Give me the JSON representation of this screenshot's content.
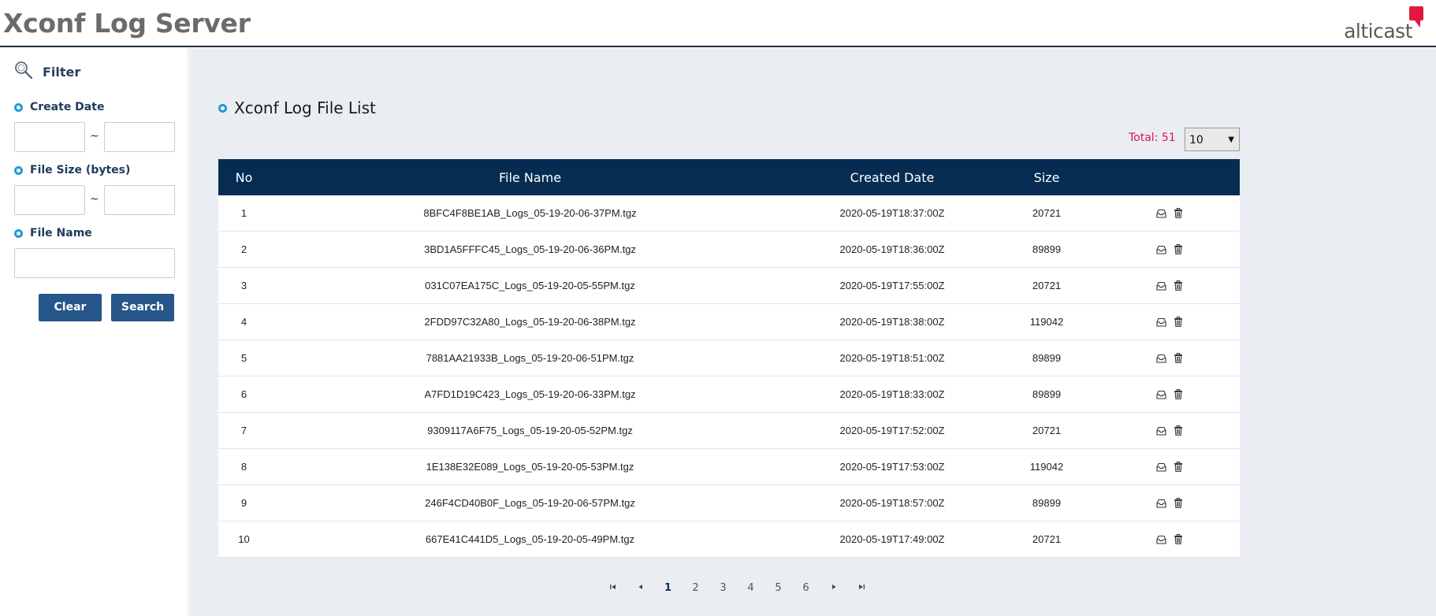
{
  "header": {
    "title": "Xconf Log Server",
    "brand": "alticast",
    "brand_color": "#e4173e"
  },
  "sidebar": {
    "filter_title": "Filter",
    "create_date_label": "Create Date",
    "file_size_label": "File Size (bytes)",
    "file_name_label": "File Name",
    "separator": "~",
    "date_from": "",
    "date_to": "",
    "size_from": "",
    "size_to": "",
    "file_name": "",
    "clear_label": "Clear",
    "search_label": "Search"
  },
  "main": {
    "list_title": "Xconf Log File List",
    "total_label": "Total: 51",
    "page_size": "10",
    "columns": {
      "no": "No",
      "name": "File Name",
      "date": "Created Date",
      "size": "Size"
    },
    "rows": [
      {
        "no": "1",
        "name": "8BFC4F8BE1AB_Logs_05-19-20-06-37PM.tgz",
        "date": "2020-05-19T18:37:00Z",
        "size": "20721"
      },
      {
        "no": "2",
        "name": "3BD1A5FFFC45_Logs_05-19-20-06-36PM.tgz",
        "date": "2020-05-19T18:36:00Z",
        "size": "89899"
      },
      {
        "no": "3",
        "name": "031C07EA175C_Logs_05-19-20-05-55PM.tgz",
        "date": "2020-05-19T17:55:00Z",
        "size": "20721"
      },
      {
        "no": "4",
        "name": "2FDD97C32A80_Logs_05-19-20-06-38PM.tgz",
        "date": "2020-05-19T18:38:00Z",
        "size": "119042"
      },
      {
        "no": "5",
        "name": "7881AA21933B_Logs_05-19-20-06-51PM.tgz",
        "date": "2020-05-19T18:51:00Z",
        "size": "89899"
      },
      {
        "no": "6",
        "name": "A7FD1D19C423_Logs_05-19-20-06-33PM.tgz",
        "date": "2020-05-19T18:33:00Z",
        "size": "89899"
      },
      {
        "no": "7",
        "name": "9309117A6F75_Logs_05-19-20-05-52PM.tgz",
        "date": "2020-05-19T17:52:00Z",
        "size": "20721"
      },
      {
        "no": "8",
        "name": "1E138E32E089_Logs_05-19-20-05-53PM.tgz",
        "date": "2020-05-19T17:53:00Z",
        "size": "119042"
      },
      {
        "no": "9",
        "name": "246F4CD40B0F_Logs_05-19-20-06-57PM.tgz",
        "date": "2020-05-19T18:57:00Z",
        "size": "89899"
      },
      {
        "no": "10",
        "name": "667E41C441D5_Logs_05-19-20-05-49PM.tgz",
        "date": "2020-05-19T17:49:00Z",
        "size": "20721"
      }
    ],
    "row_icons": [
      "download-icon",
      "trash-icon"
    ]
  },
  "pagination": {
    "first": "⏮",
    "prev": "◀",
    "next": "▶",
    "last": "⏭",
    "pages": [
      "1",
      "2",
      "3",
      "4",
      "5",
      "6"
    ],
    "current": "1"
  },
  "colors": {
    "header_bar": "#062c52",
    "button": "#26568a",
    "total_text": "#d6194b",
    "accent_dot": "#1e9bd7"
  }
}
